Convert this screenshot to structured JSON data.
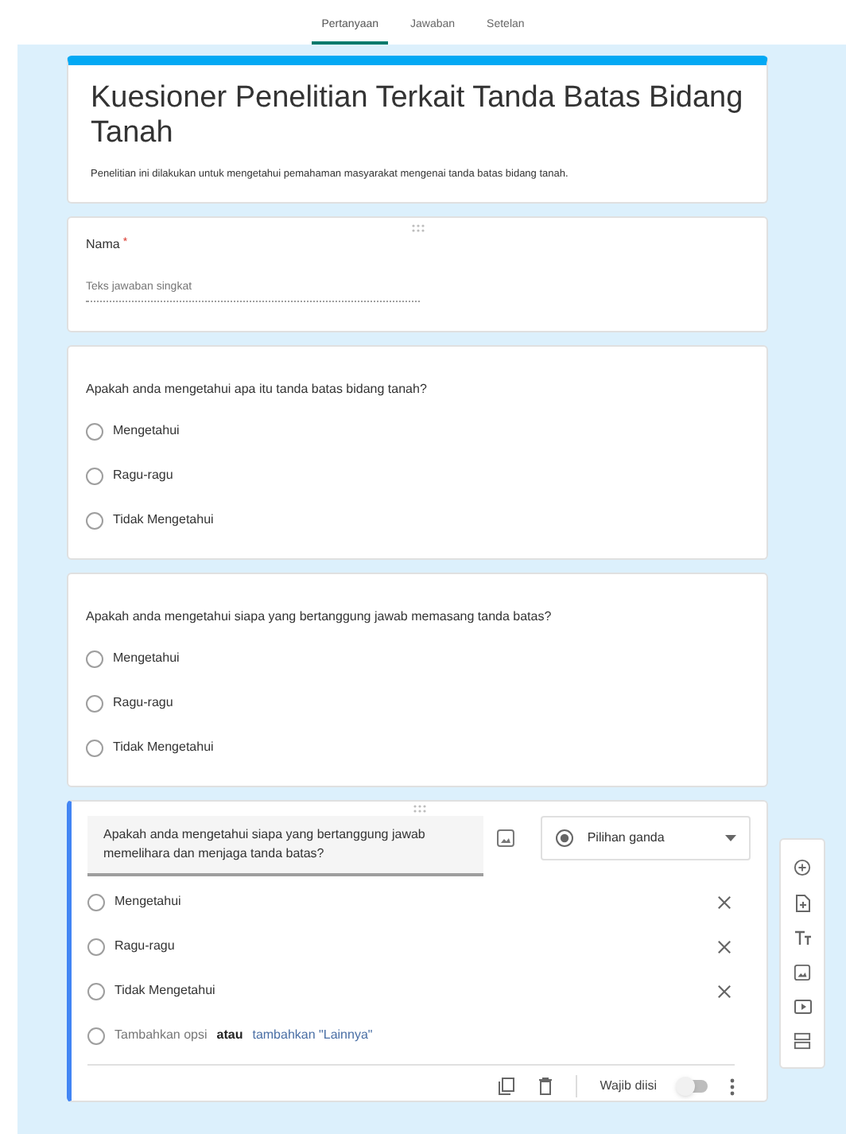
{
  "tabs": [
    {
      "label": "Pertanyaan",
      "selected": true
    },
    {
      "label": "Jawaban",
      "selected": false
    },
    {
      "label": "Setelan",
      "selected": false
    }
  ],
  "header": {
    "title": "Kuesioner Penelitian Terkait Tanda Batas Bidang Tanah",
    "description": "Penelitian ini dilakukan untuk mengetahui pemahaman masyarakat mengenai tanda batas bidang tanah."
  },
  "questions": [
    {
      "kind": "short_answer",
      "active": false,
      "title": "Nama",
      "required_mark": "*",
      "placeholder": "Teks jawaban singkat"
    },
    {
      "kind": "multiple_choice",
      "active": false,
      "title": "Apakah anda mengetahui apa itu tanda batas bidang tanah?",
      "options": [
        {
          "label": "Mengetahui",
          "selected": false
        },
        {
          "label": "Ragu-ragu",
          "selected": false
        },
        {
          "label": "Tidak Mengetahui",
          "selected": false
        }
      ]
    },
    {
      "kind": "multiple_choice",
      "active": false,
      "title": "Apakah anda mengetahui siapa yang bertanggung jawab memasang tanda batas?",
      "options": [
        {
          "label": "Mengetahui",
          "selected": false
        },
        {
          "label": "Ragu-ragu",
          "selected": false
        },
        {
          "label": "Tidak Mengetahui",
          "selected": false
        }
      ]
    },
    {
      "kind": "multiple_choice",
      "active": true,
      "title": "Apakah anda mengetahui siapa yang bertanggung jawab memelihara dan menjaga tanda batas?",
      "type_label": "Pilihan ganda",
      "options": [
        {
          "label": "Mengetahui",
          "selected": false
        },
        {
          "label": "Ragu-ragu",
          "selected": false
        },
        {
          "label": "Tidak Mengetahui",
          "selected": false
        }
      ],
      "add_option": {
        "text": "Tambahkan opsi",
        "separator": "atau",
        "other_link": "tambahkan \"Lainnya\""
      },
      "required_label": "Wajib diisi",
      "required": false
    }
  ]
}
